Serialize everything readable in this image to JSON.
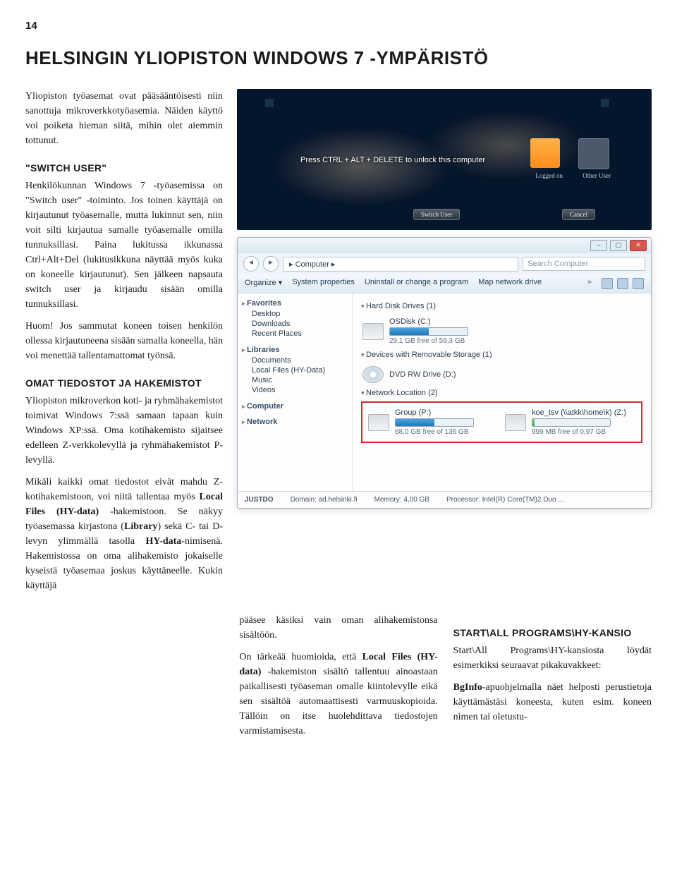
{
  "page_number": "14",
  "main_heading": "HELSINGIN YLIOPISTON WINDOWS 7 -YMPÄRISTÖ",
  "intro": "Yliopiston työasemat ovat pääsääntöisesti niin sanottuja mikroverkkotyöasemia. Näiden käyttö voi poiketa hieman siitä, mihin olet aiemmin tottunut.",
  "switch_user": {
    "heading": "\"SWITCH USER\"",
    "body": "Henkilökunnan Windows 7 -työasemissa on \"Switch user\" -toiminto. Jos toinen käyttäjä on kirjautunut työasemalle, mutta lukinnut sen, niin voit silti kirjautua samalle työasemalle omilla tunnuksillasi. Paina lukitussa ikkunassa Ctrl+Alt+Del (lukitusikkuna näyttää myös kuka on koneelle kirjautunut). Sen jälkeen napsauta switch user ja kirjaudu sisään omilla tunnuksillasi.",
    "note": "Huom! Jos sammutat koneen toisen henkilön ollessa kirjautuneena sisään samalla koneella, hän voi menettää tallentamattomat työnsä."
  },
  "omat": {
    "heading": "OMAT TIEDOSTOT JA HAKEMISTOT",
    "p1": "Yliopiston mikroverkon koti- ja ryhmähakemistot toimivat Windows 7:ssä samaan tapaan kuin Windows XP:ssä. Oma kotihakemisto sijaitsee edelleen Z-verkkolevyllä ja ryhmähakemistot P-levyllä.",
    "p2a": "Mikäli kaikki omat tiedostot eivät mahdu Z-kotihakemistoon, voi niitä tallentaa myös ",
    "p2b": "Local Files (HY-data)",
    "p2c": " -hakemistoon. Se näkyy työasemassa kirjastona (",
    "p2d": "Library",
    "p2e": ") sekä C- tai D-levyn ylimmällä tasolla ",
    "p2f": "HY-data",
    "p2g": "-nimisenä. Hakemistossa on oma alihakemisto jokaiselle kyseistä työasemaa joskus käyttäneelle. Kukin käyttäjä"
  },
  "col2": {
    "p1": "pääsee käsiksi vain oman alihakemistonsa sisältöön.",
    "p2a": "On tärkeää huomioida, että ",
    "p2b": "Local Files (HY-data)",
    "p2c": " -hakemiston sisältö tallentuu ainoastaan paikallisesti työaseman omalle kiintolevylle eikä sen sisältöä automaattisesti varmuuskopioida. Tällöin on itse huolehdittava tiedostojen varmistamisesta."
  },
  "col3": {
    "heading": "START\\ALL PROGRAMS\\HY-KANSIO",
    "p1": "Start\\All Programs\\HY-kansiosta löydät esimerkiksi seuraavat pikakuvakkeet:",
    "p2a": "BgInfo",
    "p2b": "-apuohjelmalla näet helposti perustietoja käyttämästäsi koneesta, kuten esim. koneen nimen tai oletustu-"
  },
  "lockscreen": {
    "msg": "Press CTRL + ALT + DELETE to unlock this computer",
    "logged_on": "Logged on",
    "other_user": "Other User",
    "switch_btn": "Switch User",
    "cancel_btn": "Cancel"
  },
  "explorer": {
    "breadcrumb": "▸ Computer ▸",
    "search_placeholder": "Search Computer",
    "toolbar": {
      "organize": "Organize ▾",
      "sysprops": "System properties",
      "uninstall": "Uninstall or change a program",
      "mapdrive": "Map network drive",
      "more": "»"
    },
    "nav": {
      "favorites": "Favorites",
      "desktop": "Desktop",
      "downloads": "Downloads",
      "recent": "Recent Places",
      "libraries": "Libraries",
      "documents": "Documents",
      "localfiles": "Local Files (HY-Data)",
      "music": "Music",
      "videos": "Videos",
      "computer": "Computer",
      "network": "Network"
    },
    "sections": {
      "hdd": "Hard Disk Drives (1)",
      "removable": "Devices with Removable Storage (1)",
      "netloc": "Network Location (2)"
    },
    "drives": {
      "osdisk_name": "OSDisk (C:)",
      "osdisk_sub": "29,1 GB free of 59,3 GB",
      "dvd_name": "DVD RW Drive (D:)",
      "group_name": "Group (P:)",
      "group_sub": "68,0 GB free of 136 GB",
      "z_name": "koe_tsv (\\\\atkk\\home\\k) (Z:)",
      "z_sub": "999 MB free of 0,97 GB"
    },
    "status": {
      "host": "JUSTDO",
      "domain_label": "Domain:",
      "domain": "ad.helsinki.fi",
      "mem_label": "Memory:",
      "mem": "4,00 GB",
      "proc_label": "Processor:",
      "proc": "Intel(R) Core(TM)2 Duo ..."
    }
  }
}
